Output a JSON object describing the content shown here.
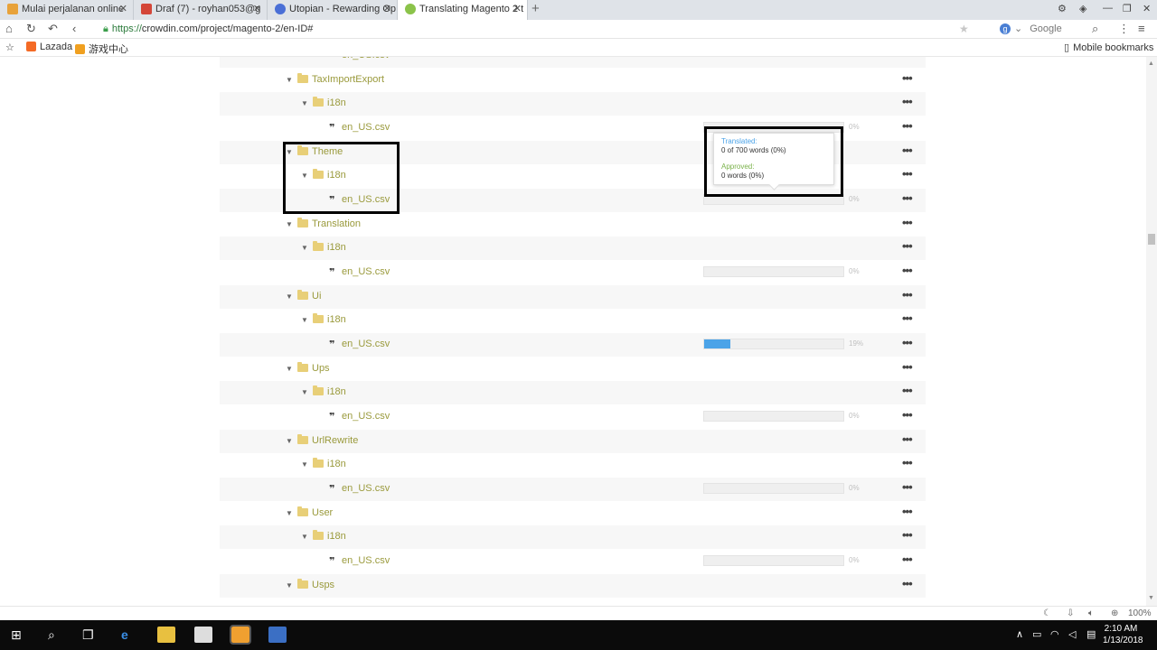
{
  "browser": {
    "tabs": [
      {
        "label": "Mulai perjalanan online",
        "icon_color": "#e8a23a"
      },
      {
        "label": "Draf (7) - royhan053@g",
        "icon_color": "#d44638"
      },
      {
        "label": "Utopian - Rewarding Op",
        "icon_color": "#4a6fd6"
      },
      {
        "label": "Translating Magento 2 t",
        "icon_color": "#8bc34a",
        "active": true
      }
    ],
    "url_scheme": "https://",
    "url_rest": "crowdin.com/project/magento-2/en-ID#",
    "search_engine": "Google",
    "bookmarks": [
      {
        "label": "Lazada",
        "icon_color": "#f46a25"
      },
      {
        "label": "游戏中心",
        "icon_color": "#f0a020"
      }
    ],
    "mobile_bookmarks": "Mobile bookmarks"
  },
  "tree": {
    "rows": [
      {
        "type": "file-cut",
        "label": "en_US.csv"
      },
      {
        "type": "folder",
        "level": 1,
        "label": "TaxImportExport"
      },
      {
        "type": "folder",
        "level": 2,
        "label": "i18n"
      },
      {
        "type": "file",
        "label": "en_US.csv",
        "progress": 0,
        "pct": "0%"
      },
      {
        "type": "folder",
        "level": 1,
        "label": "Theme"
      },
      {
        "type": "folder",
        "level": 2,
        "label": "i18n"
      },
      {
        "type": "file",
        "label": "en_US.csv",
        "progress": 0,
        "pct": "0%"
      },
      {
        "type": "folder",
        "level": 1,
        "label": "Translation"
      },
      {
        "type": "folder",
        "level": 2,
        "label": "i18n"
      },
      {
        "type": "file",
        "label": "en_US.csv",
        "progress": 0,
        "pct": "0%"
      },
      {
        "type": "folder",
        "level": 1,
        "label": "Ui"
      },
      {
        "type": "folder",
        "level": 2,
        "label": "i18n"
      },
      {
        "type": "file",
        "label": "en_US.csv",
        "progress": 0.19,
        "pct": "19%"
      },
      {
        "type": "folder",
        "level": 1,
        "label": "Ups"
      },
      {
        "type": "folder",
        "level": 2,
        "label": "i18n"
      },
      {
        "type": "file",
        "label": "en_US.csv",
        "progress": 0,
        "pct": "0%"
      },
      {
        "type": "folder",
        "level": 1,
        "label": "UrlRewrite"
      },
      {
        "type": "folder",
        "level": 2,
        "label": "i18n"
      },
      {
        "type": "file",
        "label": "en_US.csv",
        "progress": 0,
        "pct": "0%"
      },
      {
        "type": "folder",
        "level": 1,
        "label": "User"
      },
      {
        "type": "folder",
        "level": 2,
        "label": "i18n"
      },
      {
        "type": "file",
        "label": "en_US.csv",
        "progress": 0,
        "pct": "0%"
      },
      {
        "type": "folder",
        "level": 1,
        "label": "Usps"
      }
    ]
  },
  "tooltip": {
    "translated_label": "Translated:",
    "translated_value": "0 of 700 words (0%)",
    "approved_label": "Approved:",
    "approved_value": "0 words (0%)"
  },
  "statusbar": {
    "zoom": "100%"
  },
  "taskbar": {
    "time": "2:10 AM",
    "date": "1/13/2018"
  }
}
